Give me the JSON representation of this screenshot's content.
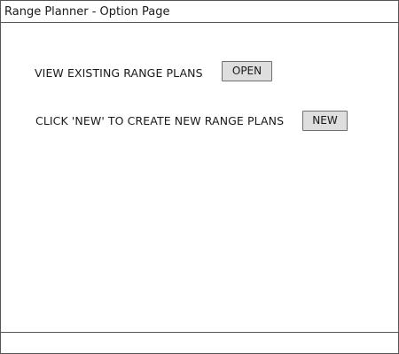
{
  "window": {
    "title": "Range Planner - Option Page"
  },
  "options": {
    "view_existing": {
      "label": "VIEW EXISTING RANGE PLANS",
      "button_label": "OPEN"
    },
    "create_new": {
      "label": "CLICK 'NEW' TO CREATE NEW RANGE PLANS",
      "button_label": "NEW"
    }
  },
  "colors": {
    "border": "#555555",
    "button_bg": "#dedede",
    "button_border": "#6e6e6e",
    "text": "#1a1a1a",
    "background": "#ffffff"
  }
}
